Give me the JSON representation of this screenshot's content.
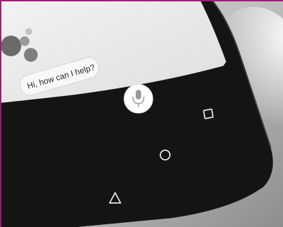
{
  "assistant": {
    "greeting": "Hi, how can I help?"
  },
  "icons": {
    "mic": "microphone-icon",
    "back": "back-triangle-icon",
    "home": "home-circle-icon",
    "recents": "recents-square-icon"
  },
  "colors": {
    "border_accent": "#b0127a",
    "phone_body": "#141414",
    "screen": "#ececec",
    "dot_dark": "#6a6a6a",
    "dot_mid": "#9a9a9a",
    "dot_light": "#c2c2c2"
  }
}
